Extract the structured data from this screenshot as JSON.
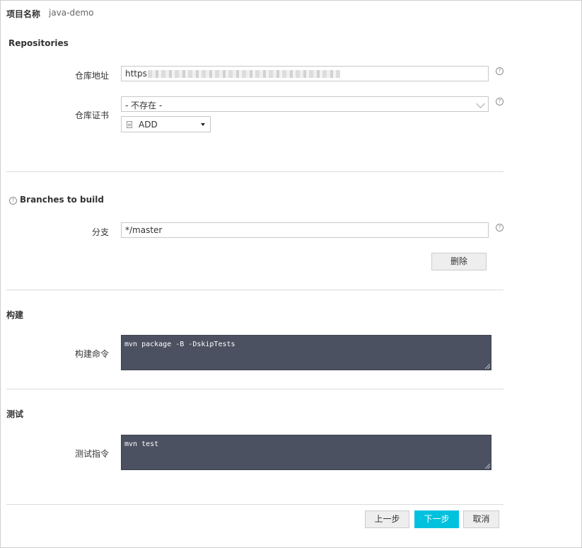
{
  "project": {
    "label": "项目名称",
    "name": "java-demo"
  },
  "repositories": {
    "title": "Repositories",
    "repo_url_label": "仓库地址",
    "repo_url_visible_prefix": "https",
    "credential_label": "仓库证书",
    "credential_selected": "- 不存在 -",
    "add_label": "ADD"
  },
  "branches": {
    "title": "Branches to build",
    "branch_label": "分支",
    "branch_value": "*/master",
    "delete_label": "删除"
  },
  "build": {
    "title": "构建",
    "command_label": "构建命令",
    "command_value": "mvn package -B -DskipTests"
  },
  "test": {
    "title": "测试",
    "command_label": "测试指令",
    "command_value": "mvn test"
  },
  "footer": {
    "prev_label": "上一步",
    "next_label": "下一步",
    "cancel_label": "取消"
  },
  "icons": {
    "help": "help-icon",
    "doc": "document-icon",
    "dropdown": "caret-down-icon"
  },
  "colors": {
    "primary": "#00c1de",
    "code_bg": "#4c5161"
  }
}
